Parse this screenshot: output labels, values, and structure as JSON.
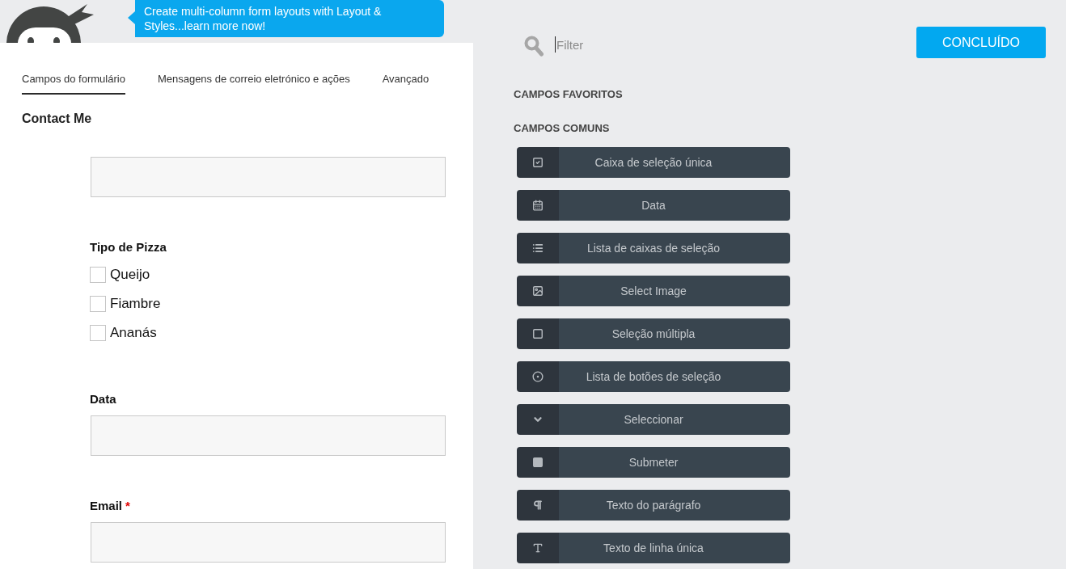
{
  "tooltip": {
    "text": "Create multi-column form layouts with Layout & Styles...learn more now!"
  },
  "tabs": [
    {
      "label": "Campos do formulário",
      "selected": true
    },
    {
      "label": "Mensagens de correio eletrónico e ações",
      "selected": false
    },
    {
      "label": "Avançado",
      "selected": false
    }
  ],
  "form": {
    "title": "Contact Me",
    "fields": [
      {
        "kind": "textbox"
      },
      {
        "kind": "checklist",
        "label": "Tipo de Pizza",
        "options": [
          {
            "label": "Queijo",
            "checked": false
          },
          {
            "label": "Fiambre",
            "checked": false
          },
          {
            "label": "Ananás",
            "checked": false
          }
        ]
      },
      {
        "kind": "textbox",
        "label": "Data"
      },
      {
        "kind": "textbox",
        "label": "Email",
        "required_mark": "*"
      }
    ]
  },
  "filter": {
    "placeholder": "Filter",
    "focused": true
  },
  "done_button": {
    "label": "CONCLUÍDO"
  },
  "sections": [
    {
      "title": "CAMPOS FAVORITOS"
    },
    {
      "title": "CAMPOS COMUNS",
      "field_types": [
        {
          "kind": "checkbox",
          "label": "Caixa de seleção única"
        },
        {
          "kind": "date",
          "label": "Data"
        },
        {
          "kind": "checklist",
          "label": "Lista de caixas de seleção"
        },
        {
          "kind": "image",
          "label": "Select Image"
        },
        {
          "kind": "multiselect",
          "label": "Seleção múltipla"
        },
        {
          "kind": "radiolist",
          "label": "Lista de botões de seleção"
        },
        {
          "kind": "select",
          "label": "Seleccionar"
        },
        {
          "kind": "submit",
          "label": "Submeter"
        },
        {
          "kind": "paragraph",
          "label": "Texto do parágrafo"
        },
        {
          "kind": "textbox",
          "label": "Texto de linha única"
        }
      ]
    }
  ]
}
